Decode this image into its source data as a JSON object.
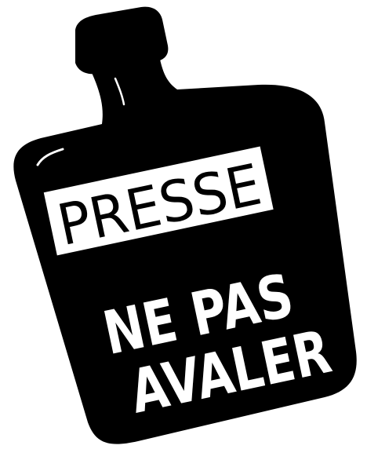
{
  "illustration": {
    "subject": "bottle",
    "label_box_text": "PRESSE",
    "line_1": "NE PAS",
    "line_2": "AVALER"
  },
  "colors": {
    "bottle": "#000000",
    "label_box": "#ffffff",
    "lettering": "#ffffff",
    "label_ink": "#000000",
    "background": "#ffffff"
  }
}
